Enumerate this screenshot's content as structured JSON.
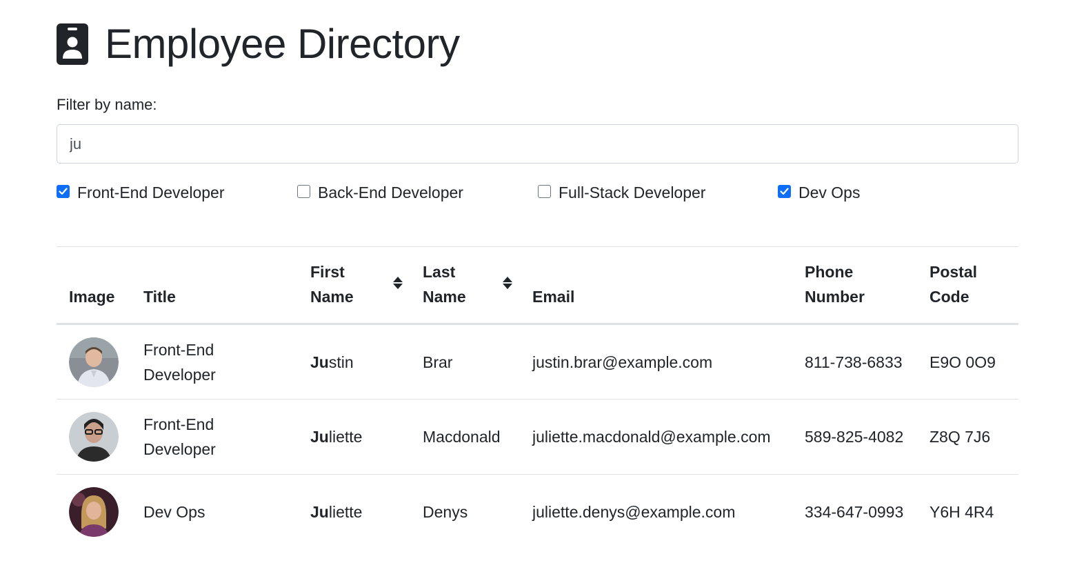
{
  "header": {
    "title": "Employee Directory",
    "icon": "id-badge-icon"
  },
  "filter": {
    "label": "Filter by name:",
    "value": "ju",
    "placeholder": ""
  },
  "role_filters": [
    {
      "label": "Front-End Developer",
      "checked": true
    },
    {
      "label": "Back-End Developer",
      "checked": false
    },
    {
      "label": "Full-Stack Developer",
      "checked": false
    },
    {
      "label": "Dev Ops",
      "checked": true
    }
  ],
  "table": {
    "columns": [
      {
        "line1": "",
        "line2": "Image",
        "sortable": false
      },
      {
        "line1": "",
        "line2": "Title",
        "sortable": false
      },
      {
        "line1": "First",
        "line2": "Name",
        "sortable": true
      },
      {
        "line1": "Last",
        "line2": "Name",
        "sortable": true
      },
      {
        "line1": "",
        "line2": "Email",
        "sortable": false
      },
      {
        "line1": "Phone",
        "line2": "Number",
        "sortable": false
      },
      {
        "line1": "Postal",
        "line2": "Code",
        "sortable": false
      }
    ],
    "rows": [
      {
        "avatar": "person-photo",
        "title": "Front-End Developer",
        "first_match": "Ju",
        "first_rest": "stin",
        "last": "Brar",
        "email": "justin.brar@example.com",
        "phone": "811-738-6833",
        "postal": "E9O 0O9"
      },
      {
        "avatar": "person-photo",
        "title": "Front-End Developer",
        "first_match": "Ju",
        "first_rest": "liette",
        "last": "Macdonald",
        "email": "juliette.macdonald@example.com",
        "phone": "589-825-4082",
        "postal": "Z8Q 7J6"
      },
      {
        "avatar": "person-photo",
        "title": "Dev Ops",
        "first_match": "Ju",
        "first_rest": "liette",
        "last": "Denys",
        "email": "juliette.denys@example.com",
        "phone": "334-647-0993",
        "postal": "Y6H 4R4"
      }
    ]
  },
  "colors": {
    "text": "#212529",
    "checkbox_accent": "#0d6efd",
    "border": "#dee2e6"
  }
}
